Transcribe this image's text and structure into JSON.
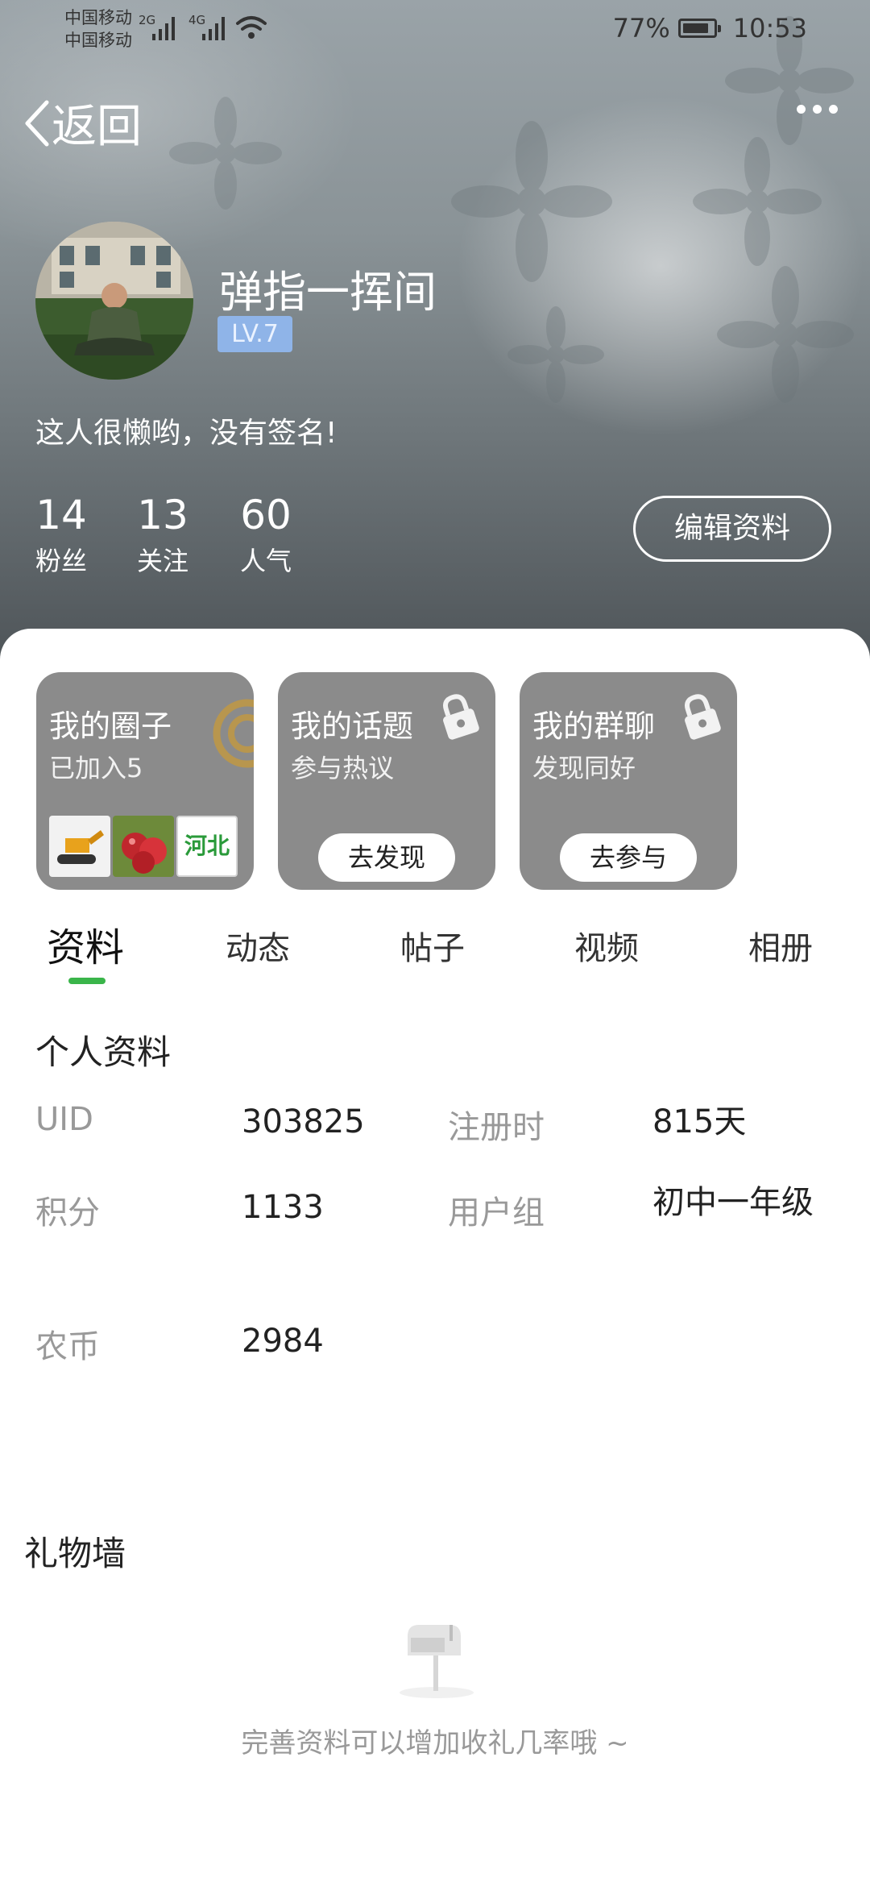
{
  "status_bar": {
    "carrier_1": "中国移动",
    "carrier_2": "中国移动",
    "net_1": "2G",
    "net_2": "4G",
    "battery": "77%",
    "time": "10:53"
  },
  "nav": {
    "back_label": "返回"
  },
  "profile": {
    "username": "弹指一挥间",
    "level": "LV.7",
    "signature": "这人很懒哟，没有签名!",
    "stats": [
      {
        "value": "14",
        "label": "粉丝"
      },
      {
        "value": "13",
        "label": "关注"
      },
      {
        "value": "60",
        "label": "人气"
      }
    ],
    "edit_label": "编辑资料"
  },
  "cards": [
    {
      "title": "我的圈子",
      "subtitle": "已加入5",
      "thumb_text": "河北"
    },
    {
      "title": "我的话题",
      "subtitle": "参与热议",
      "button": "去发现"
    },
    {
      "title": "我的群聊",
      "subtitle": "发现同好",
      "button": "去参与"
    }
  ],
  "tabs": [
    "资料",
    "动态",
    "帖子",
    "视频",
    "相册"
  ],
  "info": {
    "section_title": "个人资料",
    "fields": [
      {
        "label": "UID",
        "value": "303825"
      },
      {
        "label": "注册时",
        "value": "815天"
      },
      {
        "label": "积分",
        "value": "1133"
      },
      {
        "label": "用户组",
        "value": "初中一年级"
      },
      {
        "label": "农币",
        "value": "2984"
      }
    ]
  },
  "gift": {
    "title": "礼物墙",
    "empty_text": "完善资料可以增加收礼几率哦 ~"
  },
  "colors": {
    "accent": "#3ab54a",
    "level_badge": "#8fb4e8",
    "card_bg": "#8b8b8b"
  }
}
